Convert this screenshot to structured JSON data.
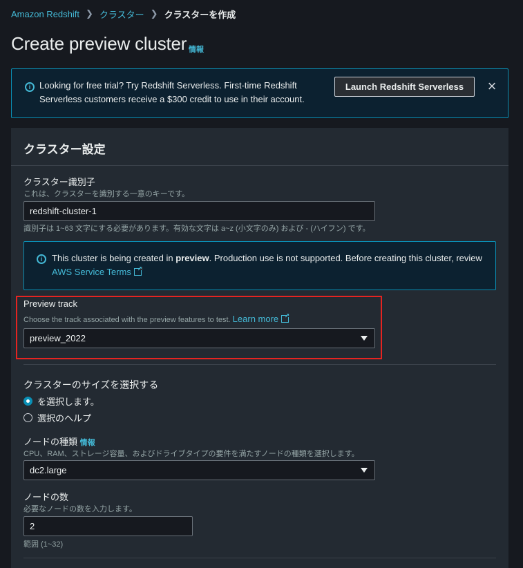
{
  "breadcrumb": {
    "service": "Amazon Redshift",
    "clusters": "クラスター",
    "current": "クラスターを作成"
  },
  "page": {
    "title": "Create preview cluster",
    "info": "情報"
  },
  "flash": {
    "message": "Looking for free trial? Try Redshift Serverless. First-time Redshift Serverless customers receive a $300 credit to use in their account.",
    "button": "Launch Redshift Serverless",
    "dismiss": "×"
  },
  "cluster_settings": {
    "title": "クラスター設定",
    "identifier": {
      "label": "クラスター識別子",
      "description": "これは、クラスターを識別する一意のキーです。",
      "value": "redshift-cluster-1",
      "constraint": "識別子は 1~63 文字にする必要があります。有効な文字は a~z (小文字のみ) および - (ハイフン) です。"
    },
    "preview_alert": {
      "prefix": "This cluster is being created in ",
      "bold": "preview",
      "suffix": ". Production use is not supported. Before creating this cluster, review",
      "link": "AWS Service Terms"
    },
    "preview_track": {
      "label": "Preview track",
      "description": "Choose the track associated with the preview features to test.",
      "learn_more": "Learn more",
      "value": "preview_2022"
    },
    "size": {
      "label": "クラスターのサイズを選択する",
      "options": [
        "を選択します。",
        "選択のヘルプ"
      ],
      "selected_index": 0
    },
    "node_type": {
      "label": "ノードの種類",
      "info": "情報",
      "description": "CPU、RAM、ストレージ容量、およびドライブタイプの要件を満たすノードの種類を選択します。",
      "value": "dc2.large"
    },
    "node_count": {
      "label": "ノードの数",
      "description": "必要なノードの数を入力します。",
      "value": "2",
      "range": "範囲 (1~32)"
    }
  },
  "colors": {
    "background": "#16191f",
    "panel": "#232a32",
    "accent_link": "#44b9d6",
    "info_border": "#0a8fb5",
    "highlight": "#e52421"
  }
}
